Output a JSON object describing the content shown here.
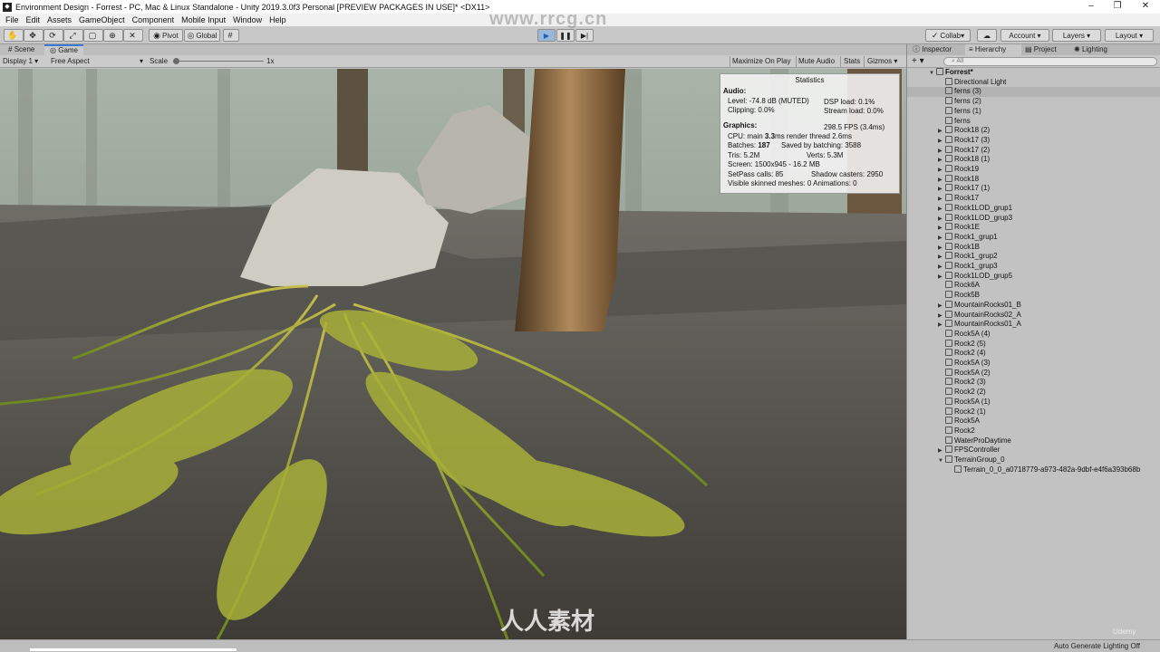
{
  "window": {
    "title": "Environment Design - Forrest - PC, Mac & Linux Standalone - Unity 2019.3.0f3 Personal [PREVIEW PACKAGES IN USE]* <DX11>",
    "controls": [
      "–",
      "❐",
      "✕"
    ]
  },
  "menu": [
    "File",
    "Edit",
    "Assets",
    "GameObject",
    "Component",
    "Mobile Input",
    "Window",
    "Help"
  ],
  "toolbar": {
    "pivot_label": "Pivot",
    "global_label": "Global",
    "collab_label": "Collab",
    "account_label": "Account",
    "layers_label": "Layers",
    "layout_label": "Layout",
    "play_active": true
  },
  "tabs": {
    "scene": "Scene",
    "game": "Game"
  },
  "gamebar": {
    "display": "Display 1",
    "aspect": "Free Aspect",
    "scale_label": "Scale",
    "scale_value": "1x",
    "maximize": "Maximize On Play",
    "mute": "Mute Audio",
    "stats": "Stats",
    "gizmos": "Gizmos"
  },
  "stats": {
    "title": "Statistics",
    "audio_header": "Audio:",
    "level": "Level: -74.8 dB (MUTED)",
    "clipping": "Clipping: 0.0%",
    "dsp": "DSP load: 0.1%",
    "stream": "Stream load: 0.0%",
    "graphics_header": "Graphics:",
    "fps": "298.5 FPS (3.4ms)",
    "cpu_prefix": "CPU: main ",
    "cpu_main": "3.3",
    "cpu_suffix": "ms  render thread 2.6ms",
    "batches_prefix": "Batches: ",
    "batches": "187",
    "saved": "Saved by batching: 3588",
    "tris": "Tris: 5.2M",
    "verts": "Verts: 5.3M",
    "screen": "Screen: 1500x945 - 16.2 MB",
    "setpass": "SetPass calls: 85",
    "shadow": "Shadow casters: 2950",
    "skinned": "Visible skinned meshes: 0  Animations: 0"
  },
  "right_tabs": {
    "inspector": "Inspector",
    "hierarchy": "Hierarchy",
    "project": "Project",
    "lighting": "Lighting"
  },
  "hierarchy_search": "All",
  "hierarchy": [
    {
      "label": "Forrest*",
      "arrow": "▼",
      "indent": 0,
      "scene": true
    },
    {
      "label": "Directional Light",
      "arrow": "",
      "indent": 1
    },
    {
      "label": "ferns (3)",
      "arrow": "",
      "indent": 1,
      "selected": true
    },
    {
      "label": "ferns (2)",
      "arrow": "",
      "indent": 1
    },
    {
      "label": "ferns (1)",
      "arrow": "",
      "indent": 1
    },
    {
      "label": "ferns",
      "arrow": "",
      "indent": 1
    },
    {
      "label": "Rock18 (2)",
      "arrow": "▶",
      "indent": 1
    },
    {
      "label": "Rock17 (3)",
      "arrow": "▶",
      "indent": 1
    },
    {
      "label": "Rock17 (2)",
      "arrow": "▶",
      "indent": 1
    },
    {
      "label": "Rock18 (1)",
      "arrow": "▶",
      "indent": 1
    },
    {
      "label": "Rock19",
      "arrow": "▶",
      "indent": 1
    },
    {
      "label": "Rock18",
      "arrow": "▶",
      "indent": 1
    },
    {
      "label": "Rock17 (1)",
      "arrow": "▶",
      "indent": 1
    },
    {
      "label": "Rock17",
      "arrow": "▶",
      "indent": 1
    },
    {
      "label": "Rock1LOD_grup1",
      "arrow": "▶",
      "indent": 1
    },
    {
      "label": "Rock1LOD_grup3",
      "arrow": "▶",
      "indent": 1
    },
    {
      "label": "Rock1E",
      "arrow": "▶",
      "indent": 1
    },
    {
      "label": "Rock1_grup1",
      "arrow": "▶",
      "indent": 1
    },
    {
      "label": "Rock1B",
      "arrow": "▶",
      "indent": 1
    },
    {
      "label": "Rock1_grup2",
      "arrow": "▶",
      "indent": 1
    },
    {
      "label": "Rock1_grup3",
      "arrow": "▶",
      "indent": 1
    },
    {
      "label": "Rock1LOD_grup5",
      "arrow": "▶",
      "indent": 1
    },
    {
      "label": "Rock6A",
      "arrow": "",
      "indent": 1
    },
    {
      "label": "Rock5B",
      "arrow": "",
      "indent": 1
    },
    {
      "label": "MountainRocks01_B",
      "arrow": "▶",
      "indent": 1
    },
    {
      "label": "MountainRocks02_A",
      "arrow": "▶",
      "indent": 1
    },
    {
      "label": "MountainRocks01_A",
      "arrow": "▶",
      "indent": 1
    },
    {
      "label": "Rock5A (4)",
      "arrow": "",
      "indent": 1
    },
    {
      "label": "Rock2 (5)",
      "arrow": "",
      "indent": 1
    },
    {
      "label": "Rock2 (4)",
      "arrow": "",
      "indent": 1
    },
    {
      "label": "Rock5A (3)",
      "arrow": "",
      "indent": 1
    },
    {
      "label": "Rock5A (2)",
      "arrow": "",
      "indent": 1
    },
    {
      "label": "Rock2 (3)",
      "arrow": "",
      "indent": 1
    },
    {
      "label": "Rock2 (2)",
      "arrow": "",
      "indent": 1
    },
    {
      "label": "Rock5A (1)",
      "arrow": "",
      "indent": 1
    },
    {
      "label": "Rock2 (1)",
      "arrow": "",
      "indent": 1
    },
    {
      "label": "Rock5A",
      "arrow": "",
      "indent": 1
    },
    {
      "label": "Rock2",
      "arrow": "",
      "indent": 1
    },
    {
      "label": "WaterProDaytime",
      "arrow": "",
      "indent": 1
    },
    {
      "label": "FPSController",
      "arrow": "▶",
      "indent": 1
    },
    {
      "label": "TerrainGroup_0",
      "arrow": "▼",
      "indent": 1
    },
    {
      "label": "Terrain_0_0_a0718779-a973-482a-9dbf-e4f6a393b68b",
      "arrow": "",
      "indent": 2
    }
  ],
  "status": {
    "right": "Auto Generate Lighting Off",
    "udemy": "Udemy"
  },
  "watermark": {
    "top": "www.rrcg.cn",
    "bottom": "人人素材"
  }
}
